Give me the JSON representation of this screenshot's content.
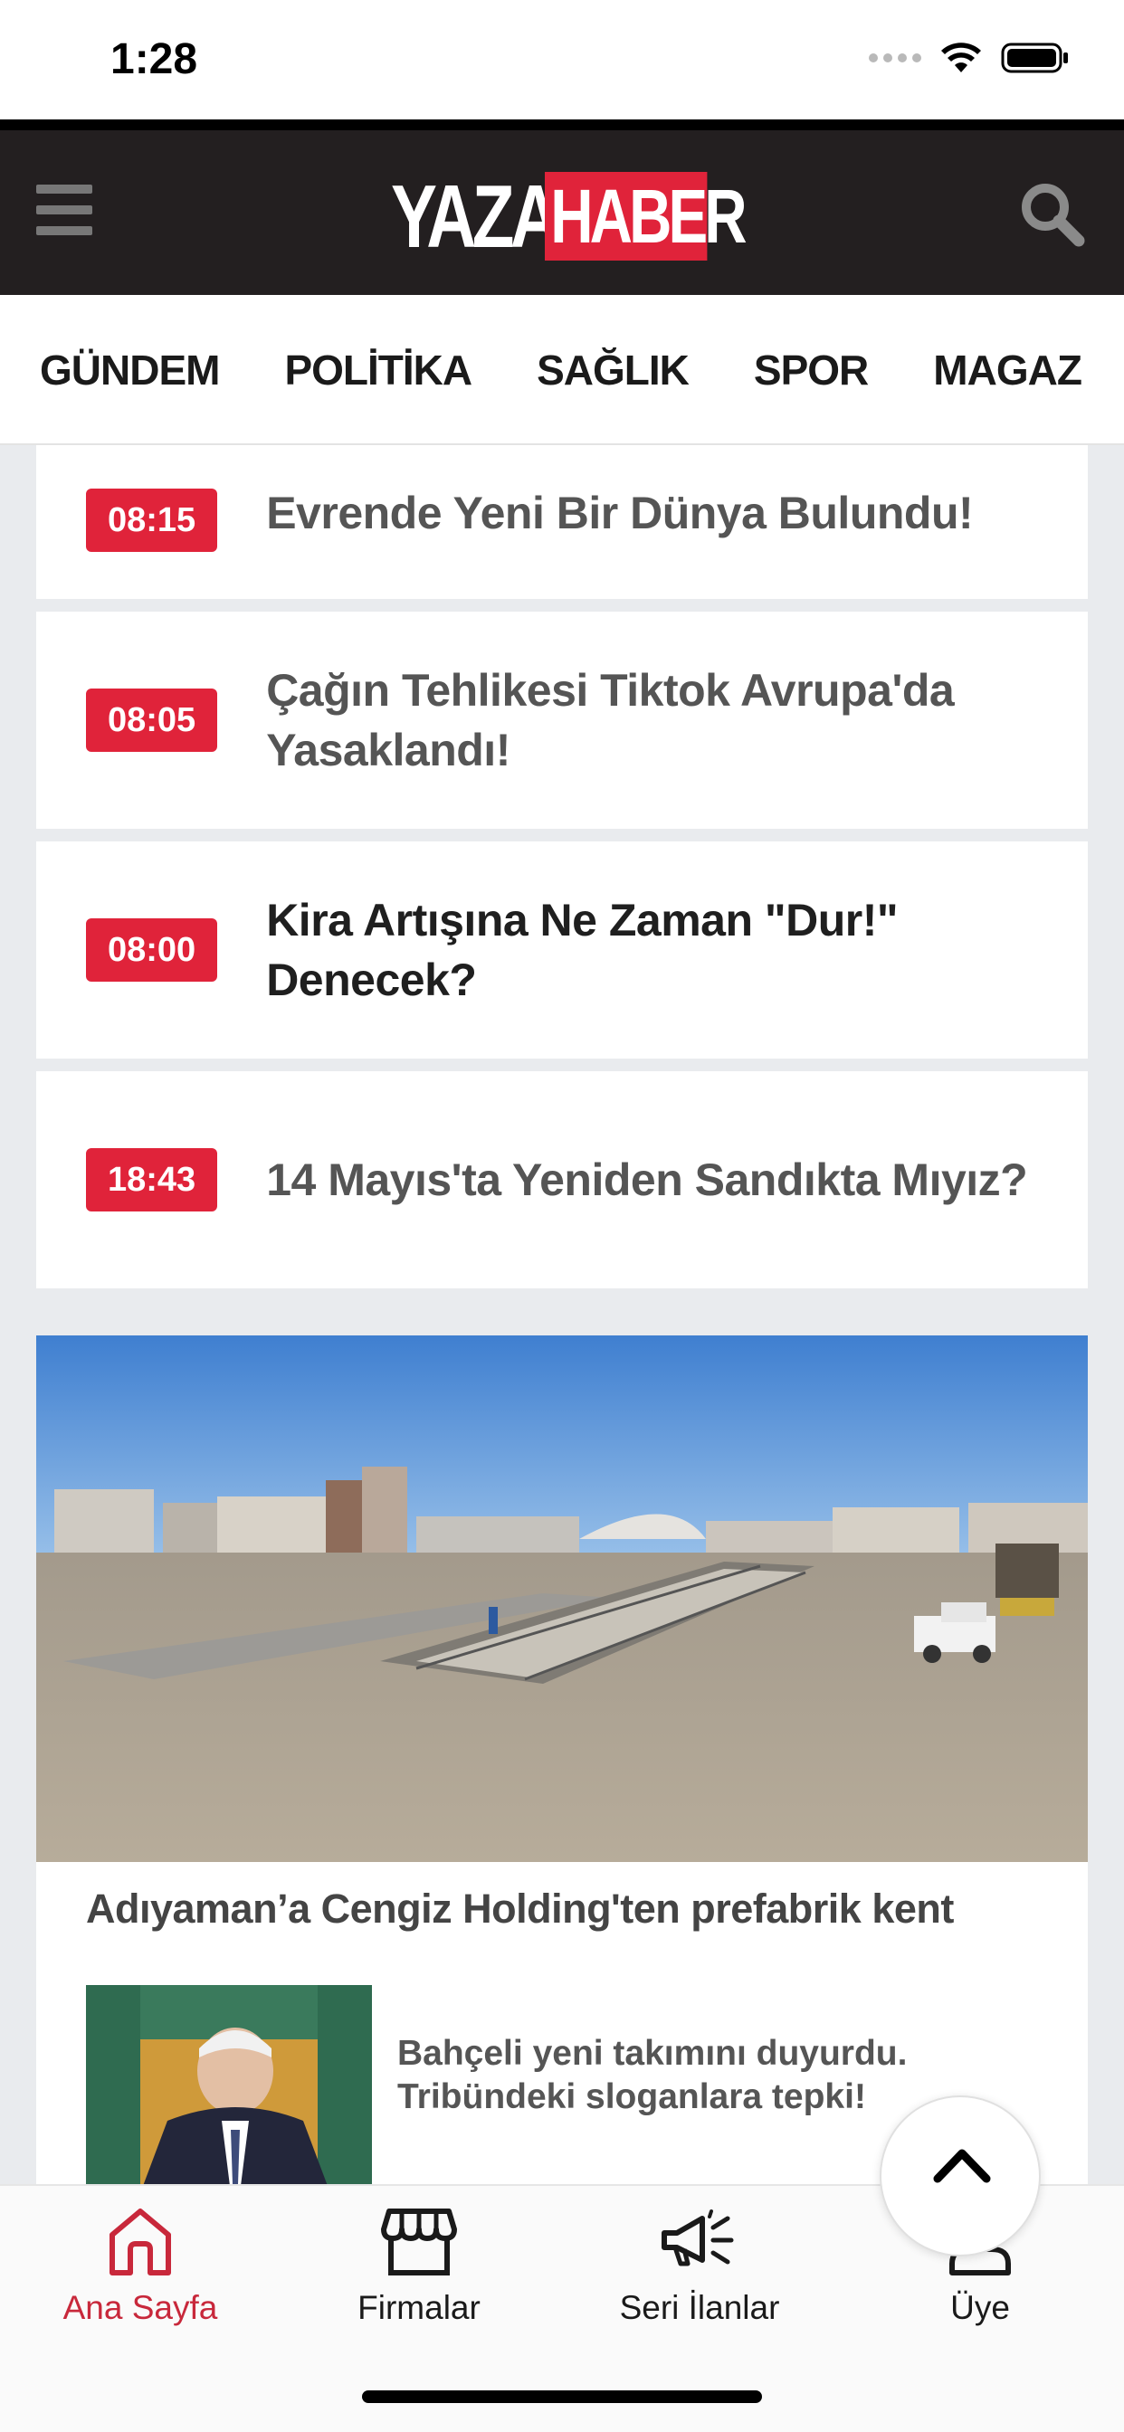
{
  "status_bar": {
    "time": "1:28"
  },
  "header": {
    "logo_part1": "YAZAR",
    "logo_part2": "HABER",
    "brand_color": "#e0233a"
  },
  "categories": [
    "GÜNDEM",
    "POLİTİKA",
    "SAĞLIK",
    "SPOR",
    "MAGAZ"
  ],
  "news": [
    {
      "time": "08:15",
      "title": "Evrende Yeni Bir Dünya Bulundu!"
    },
    {
      "time": "08:05",
      "title": "Çağın Tehlikesi Tiktok Avrupa'da Yasaklandı!"
    },
    {
      "time": "08:00",
      "title": "Kira Artışına Ne Zaman \"Dur!\" Denecek?"
    },
    {
      "time": "18:43",
      "title": "14 Mayıs'ta Yeniden Sandıkta Mıyız?"
    }
  ],
  "feature": {
    "title": "Adıyaman’a Cengiz Holding'ten prefabrik kent"
  },
  "sub_news": {
    "line1": "Bahçeli yeni takımını duyurdu.",
    "line2": "Tribündeki sloganlara tepki!"
  },
  "tabs": [
    {
      "label": "Ana Sayfa",
      "icon": "home-icon",
      "active": true
    },
    {
      "label": "Firmalar",
      "icon": "store-icon",
      "active": false
    },
    {
      "label": "Seri İlanlar",
      "icon": "megaphone-icon",
      "active": false
    },
    {
      "label": "Üye",
      "icon": "user-icon",
      "active": false
    }
  ],
  "colors": {
    "active_tab": "#c8283b",
    "time_badge": "#e0233a",
    "header_bg": "#231f20"
  }
}
